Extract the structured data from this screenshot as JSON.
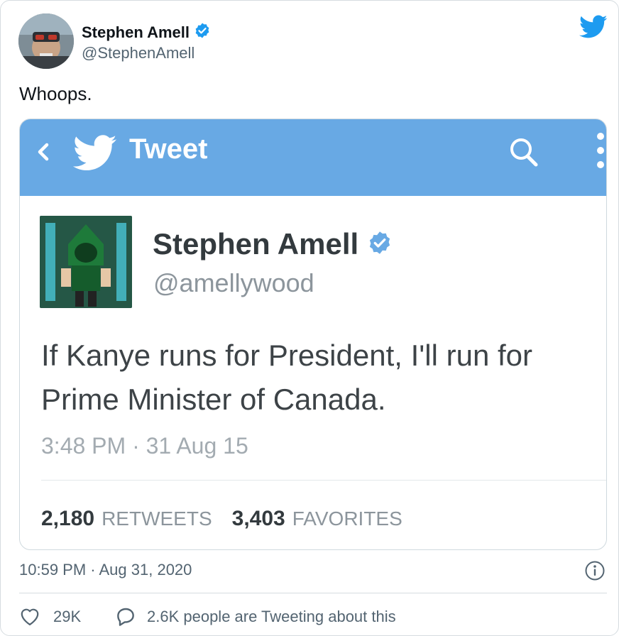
{
  "tweet": {
    "author_name": "Stephen Amell",
    "author_handle": "@StephenAmell",
    "text": "Whoops.",
    "timestamp": "10:59 PM · Aug 31, 2020",
    "like_count": "29K",
    "conversation_text": "2.6K people are Tweeting about this"
  },
  "embedded": {
    "bar_title": "Tweet",
    "author_name": "Stephen Amell",
    "author_handle": "@amellywood",
    "text_line1": "If Kanye runs for President, I'll run for",
    "text_line2": "Prime Minister of Canada.",
    "time": "3:48 PM · 31 Aug 15",
    "retweets_count": "2,180",
    "retweets_label": "RETWEETS",
    "favorites_count": "3,403",
    "favorites_label": "FAVORITES"
  },
  "icons": {
    "verified": "verified-badge-icon",
    "twitter": "twitter-bird-icon",
    "back": "chevron-left-icon",
    "search": "search-icon",
    "more": "more-vertical-icon",
    "info": "info-icon",
    "like": "heart-icon",
    "reply": "speech-bubble-icon"
  },
  "colors": {
    "brand_blue": "#1d9bf0",
    "embed_bar": "#68a9e4",
    "secondary_text": "#536471"
  }
}
